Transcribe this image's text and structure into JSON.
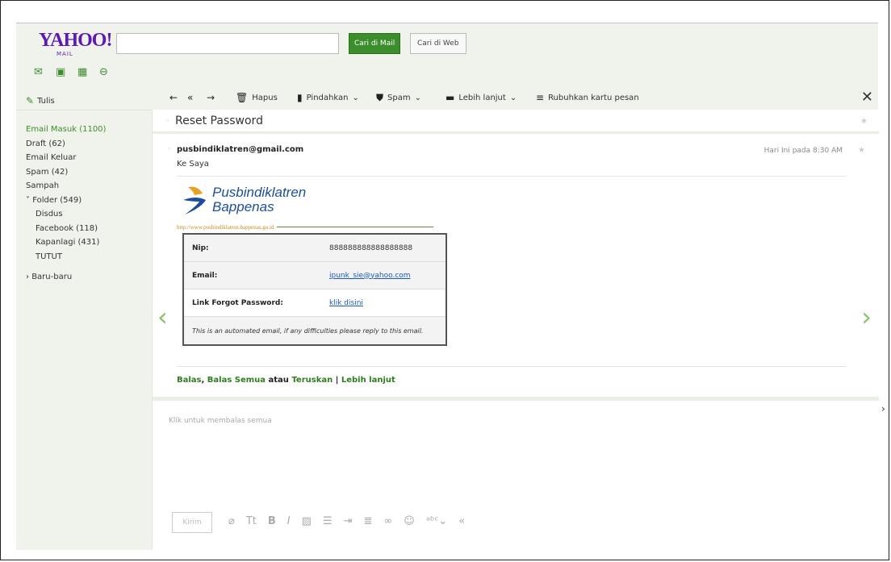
{
  "header": {
    "logo": "YAHOO!",
    "logo_sub": "MAIL",
    "search_value": "",
    "search_mail_button": "Cari di Mail",
    "search_web_button": "Cari di Web",
    "app_icons": [
      "mail-icon",
      "contacts-icon",
      "calendar-icon",
      "notepad-icon"
    ]
  },
  "sidebar": {
    "compose": "Tulis",
    "folders": [
      {
        "label": "Email Masuk (1100)",
        "active": true
      },
      {
        "label": "Draft (62)"
      },
      {
        "label": "Email Keluar"
      },
      {
        "label": "Spam (42)"
      },
      {
        "label": "Sampah"
      },
      {
        "label": "Folder (549)",
        "expandable": true
      },
      {
        "label": "Disdus",
        "sub": true
      },
      {
        "label": "Facebook (118)",
        "sub": true
      },
      {
        "label": "Kapanlagi (431)",
        "sub": true
      },
      {
        "label": "TUTUT",
        "sub": true
      },
      {
        "label": "Baru-baru",
        "collapsed": true
      }
    ]
  },
  "toolbar": {
    "delete": "Hapus",
    "move": "Pindahkan",
    "spam": "Spam",
    "more": "Lebih lanjut",
    "collapse": "Rubuhkan kartu pesan"
  },
  "message": {
    "subject": "Reset Password",
    "sender": "pusbindiklatren@gmail.com",
    "to": "Ke Saya",
    "date": "Hari Ini pada 8:30 AM",
    "brand_line1": "Pusbindiklatren",
    "brand_line2": "Bappenas",
    "brand_url": "http://www.pusbindiklatren.bappenas.go.id",
    "table": {
      "nip_label": "Nip:",
      "nip_value": "888888888888888888",
      "email_label": "Email:",
      "email_value": "ipunk_sie@yahoo.com",
      "link_label": "Link Forgot Password:",
      "link_value": "klik disini",
      "note": "This is an automated email, if any difficulties please reply to this email."
    },
    "actions": {
      "reply": "Balas",
      "reply_all": "Balas Semua",
      "or": "atau",
      "forward": "Teruskan",
      "more": "Lebih lanjut"
    }
  },
  "reply": {
    "placeholder": "Klik untuk membalas semua",
    "send": "Kirim"
  },
  "colors": {
    "brand_purple": "#5b1ab4",
    "accent_green": "#3c8d2c",
    "chrome_bg": "#f0f3ec"
  }
}
